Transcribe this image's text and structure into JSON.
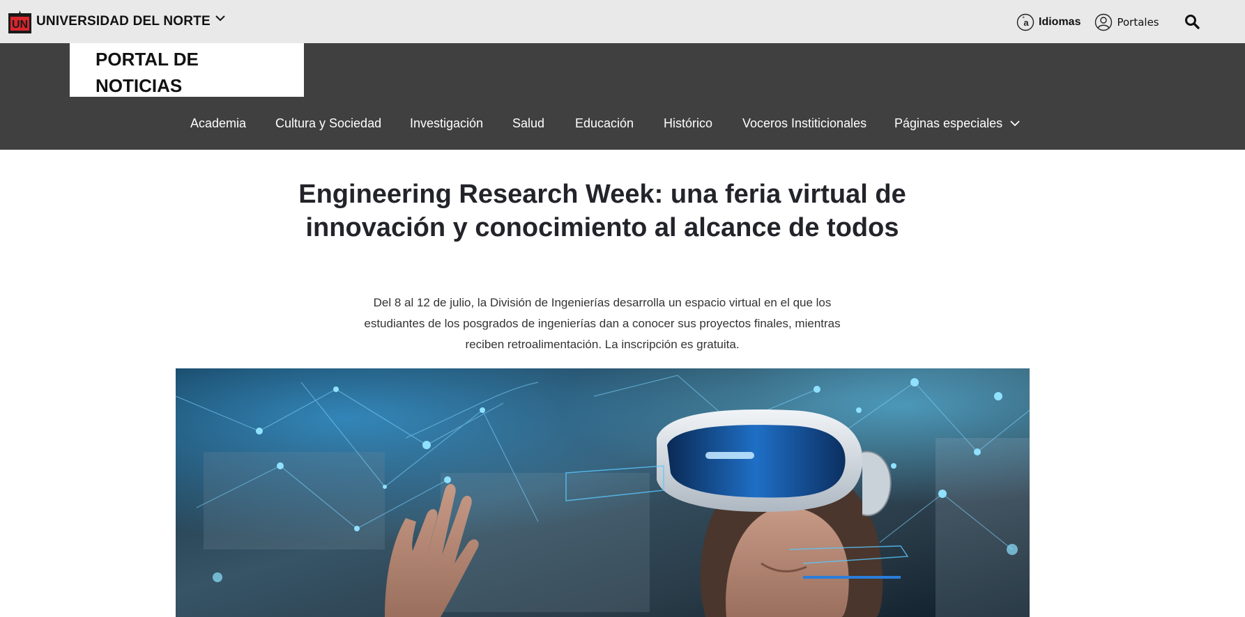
{
  "topbar": {
    "brand_name": "UNIVERSIDAD DEL NORTE",
    "brand_logo_letters": "UN",
    "idiomas_label": "Idiomas",
    "idiomas_icon_glyph": "a",
    "portales_label": "Portales",
    "icons": {
      "brand": "un-logo-icon",
      "menu": "chevron-down-icon",
      "lang": "language-icon",
      "user": "user-icon",
      "search": "search-icon"
    }
  },
  "header": {
    "portal_title": "PORTAL DE NOTICIAS",
    "nav": [
      {
        "label": "Academia"
      },
      {
        "label": "Cultura y Sociedad"
      },
      {
        "label": "Investigación"
      },
      {
        "label": "Salud"
      },
      {
        "label": "Educación"
      },
      {
        "label": "Histórico"
      },
      {
        "label": "Voceros Institicionales"
      },
      {
        "label": "Páginas especiales",
        "has_dropdown": true
      }
    ]
  },
  "article": {
    "title": "Engineering Research Week: una feria virtual de innovación y conocimiento al alcance de todos",
    "lead": "Del 8 al 12 de julio, la División de Ingenierías desarrolla un espacio virtual en el que los estudiantes de los posgrados de ingenierías dan a conocer sus proyectos finales, mientras reciben retroalimentación. La inscripción es gratuita.",
    "hero_image": "vr-headset-woman-network-image"
  },
  "colors": {
    "topbar_bg": "#e9e9e9",
    "band_bg": "#404040",
    "brand_red": "#d9262c",
    "text_dark": "#23242a",
    "nav_text": "#ffffff"
  }
}
